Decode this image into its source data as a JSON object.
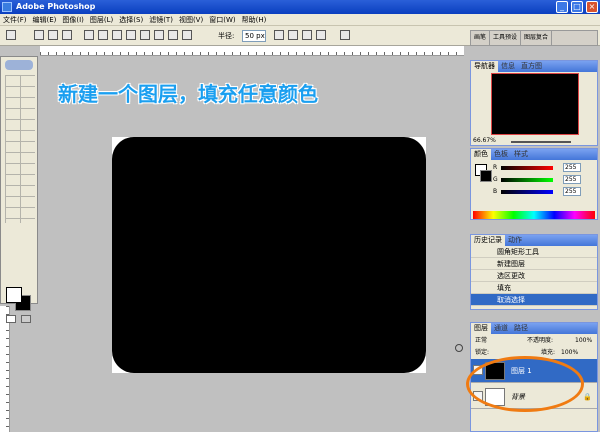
{
  "app": {
    "title": "Adobe Photoshop"
  },
  "menubar": [
    "文件(F)",
    "编辑(E)",
    "图像(I)",
    "图层(L)",
    "选择(S)",
    "滤镜(T)",
    "视图(V)",
    "窗口(W)",
    "帮助(H)"
  ],
  "options": {
    "feather_label": "半径:",
    "feather_value": "50 px"
  },
  "palette_well": {
    "tabs": [
      "画笔",
      "工具预设",
      "图层复合"
    ]
  },
  "annotation": "新建一个图层，填充任意颜色",
  "navigator": {
    "tabs": [
      "导航器",
      "信息",
      "直方图"
    ],
    "zoom": "66.67%"
  },
  "color": {
    "tabs": [
      "颜色",
      "色板",
      "样式"
    ],
    "r_label": "R",
    "g_label": "G",
    "b_label": "B",
    "r": "255",
    "g": "255",
    "b": "255"
  },
  "history": {
    "tabs": [
      "历史记录",
      "动作"
    ],
    "items": [
      "圆角矩形工具",
      "新建图层",
      "选区更改",
      "填充",
      "取消选择"
    ]
  },
  "layers": {
    "tabs": [
      "图层",
      "通道",
      "路径"
    ],
    "blend": "正常",
    "opacity_label": "不透明度:",
    "opacity": "100%",
    "lock_label": "锁定:",
    "fill_label": "填充:",
    "fill": "100%",
    "rows": [
      {
        "name": "图层 1"
      },
      {
        "name": "背景"
      }
    ]
  },
  "colors": {
    "highlight": "#316ac5",
    "annotation": "#1a9ff0",
    "ring": "#f07b12",
    "canvas_shape": "#000000"
  }
}
